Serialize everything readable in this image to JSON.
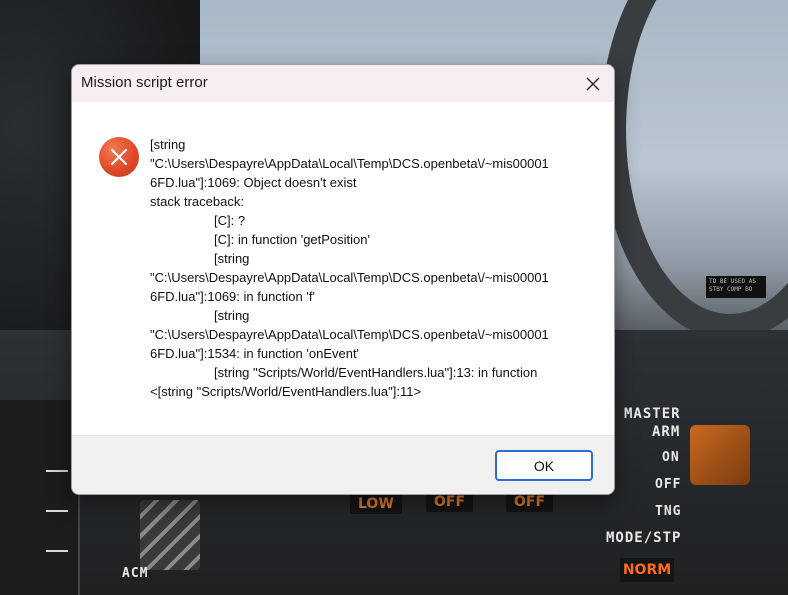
{
  "dialog": {
    "title": "Mission script error",
    "message_lines": [
      "[string",
      "\"C:\\Users\\Despayre\\AppData\\Local\\Temp\\DCS.openbeta\\/~mis00001",
      "6FD.lua\"]:1069: Object doesn't exist",
      "stack traceback:",
      "[C]: ?",
      "[C]: in function 'getPosition'",
      "[string",
      "\"C:\\Users\\Despayre\\AppData\\Local\\Temp\\DCS.openbeta\\/~mis00001",
      "6FD.lua\"]:1069: in function 'f'",
      "[string",
      "\"C:\\Users\\Despayre\\AppData\\Local\\Temp\\DCS.openbeta\\/~mis00001",
      "6FD.lua\"]:1534: in function 'onEvent'",
      "[string \"Scripts/World/EventHandlers.lua\"]:13: in function",
      "<[string \"Scripts/World/EventHandlers.lua\"]:11>"
    ],
    "ok_label": "OK",
    "icon": "error-icon"
  },
  "background": {
    "labels": {
      "master_arm": "MASTER",
      "arm": "ARM",
      "on": "ON",
      "off": "OFF",
      "tng": "TNG",
      "mode_stp": "MODE/STP",
      "norm": "NORM",
      "low": "LOW",
      "off_1": "OFF",
      "off_2": "OFF",
      "acm": "ACM",
      "placard": "TO BE USED AS STBY COMP BO"
    }
  },
  "colors": {
    "title_bar": "#f7eef1",
    "error_red": "#e0492a",
    "accent_blue": "#2a6fd1"
  }
}
